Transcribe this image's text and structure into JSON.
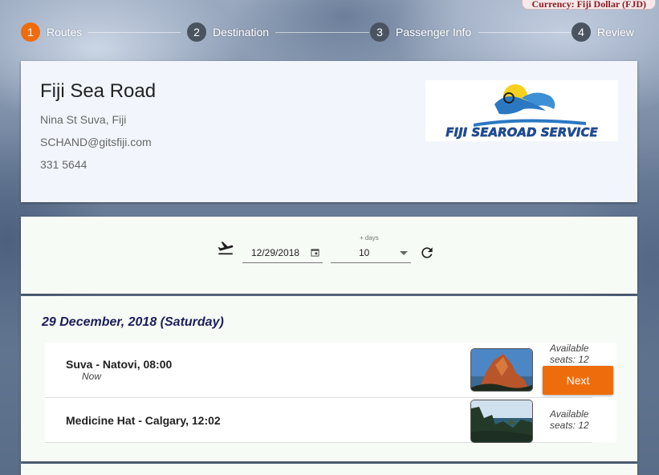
{
  "currency": "Currency: Fiji Dollar (FJD)",
  "steps": [
    {
      "number": "1",
      "label": "Routes"
    },
    {
      "number": "2",
      "label": "Destination"
    },
    {
      "number": "3",
      "label": "Passenger Info"
    },
    {
      "number": "4",
      "label": "Review"
    }
  ],
  "company": {
    "name": "Fiji Sea Road",
    "address": "Nina St Suva, Fiji",
    "email": "SCHAND@gitsfiji.com",
    "phone": "331 5644",
    "logo_text": "FIJI SEAROAD SERVICE"
  },
  "search": {
    "depart_icon": "flight-takeoff-icon",
    "date_value": "12/29/2018",
    "days_label": "+ days",
    "days_value": "10",
    "refresh_icon": "refresh-icon"
  },
  "results": {
    "day_heading": "29 December, 2018 (Saturday)",
    "trips": [
      {
        "title": "Suva - Natovi, 08:00",
        "subtitle": "Now",
        "seats": "Available seats: 12",
        "action": "Next"
      },
      {
        "title": "Medicine Hat - Calgary, 12:02",
        "subtitle": "",
        "seats": "Available seats: 12"
      }
    ]
  },
  "colors": {
    "accent": "#ef6c0d",
    "heading": "#1b1e5a",
    "currency": "#8a1b24"
  }
}
